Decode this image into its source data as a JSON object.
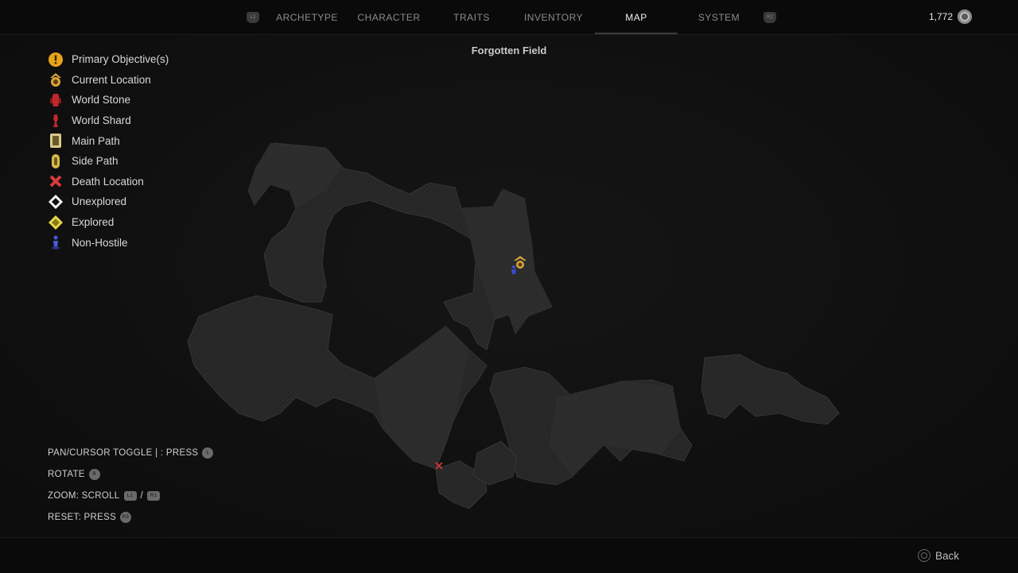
{
  "nav": {
    "left_shoulder": "L2",
    "right_shoulder": "R2",
    "tabs": [
      {
        "label": "ARCHETYPE",
        "active": false
      },
      {
        "label": "CHARACTER",
        "active": false
      },
      {
        "label": "TRAITS",
        "active": false
      },
      {
        "label": "INVENTORY",
        "active": false
      },
      {
        "label": "MAP",
        "active": true
      },
      {
        "label": "SYSTEM",
        "active": false
      }
    ],
    "currency": "1,772",
    "currency_icon": "scrap-coin-icon"
  },
  "map": {
    "area_name": "Forgotten Field"
  },
  "legend": [
    {
      "label": "Primary Objective(s)",
      "icon": "primary-objective-icon",
      "color": "#e6a21a"
    },
    {
      "label": "Current Location",
      "icon": "current-location-icon",
      "color": "#d9a43a"
    },
    {
      "label": "World Stone",
      "icon": "world-stone-icon",
      "color": "#c0262b"
    },
    {
      "label": "World Shard",
      "icon": "world-shard-icon",
      "color": "#c0262b"
    },
    {
      "label": "Main Path",
      "icon": "main-path-icon",
      "color": "#d8c98a"
    },
    {
      "label": "Side Path",
      "icon": "side-path-icon",
      "color": "#d6b94a"
    },
    {
      "label": "Death Location",
      "icon": "death-location-icon",
      "color": "#d83a3a"
    },
    {
      "label": "Unexplored",
      "icon": "unexplored-icon",
      "color": "#ffffff"
    },
    {
      "label": "Explored",
      "icon": "explored-icon",
      "color": "#e8d84a"
    },
    {
      "label": "Non-Hostile",
      "icon": "non-hostile-icon",
      "color": "#4a5ad8"
    }
  ],
  "controls": {
    "pan": "PAN/CURSOR TOGGLE | : PRESS",
    "pan_button": "L",
    "rotate": "ROTATE",
    "rotate_button": "R",
    "zoom": "ZOOM: SCROLL",
    "zoom_btn1": "L1",
    "zoom_sep": "/",
    "zoom_btn2": "R1",
    "reset": "RESET: PRESS",
    "reset_button": "R3"
  },
  "footer": {
    "back_label": "Back",
    "back_icon": "circle-button-icon"
  }
}
